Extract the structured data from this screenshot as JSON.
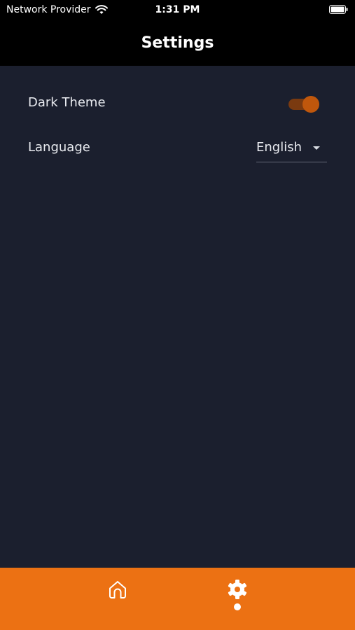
{
  "status_bar": {
    "carrier": "Network Provider",
    "time": "1:31 PM",
    "wifi_icon": "wifi-icon",
    "battery_icon": "battery-icon"
  },
  "header": {
    "title": "Settings"
  },
  "settings": {
    "dark_theme": {
      "label": "Dark Theme",
      "enabled": true
    },
    "language": {
      "label": "Language",
      "selected": "English"
    }
  },
  "tab_bar": {
    "tabs": [
      {
        "icon": "home-icon",
        "active": false
      },
      {
        "icon": "gear-icon",
        "active": true
      }
    ]
  },
  "colors": {
    "background": "#1b1f2e",
    "header": "#000000",
    "accent": "#ec7113",
    "toggle_thumb": "#c0570c",
    "toggle_track": "#7a3a10"
  }
}
